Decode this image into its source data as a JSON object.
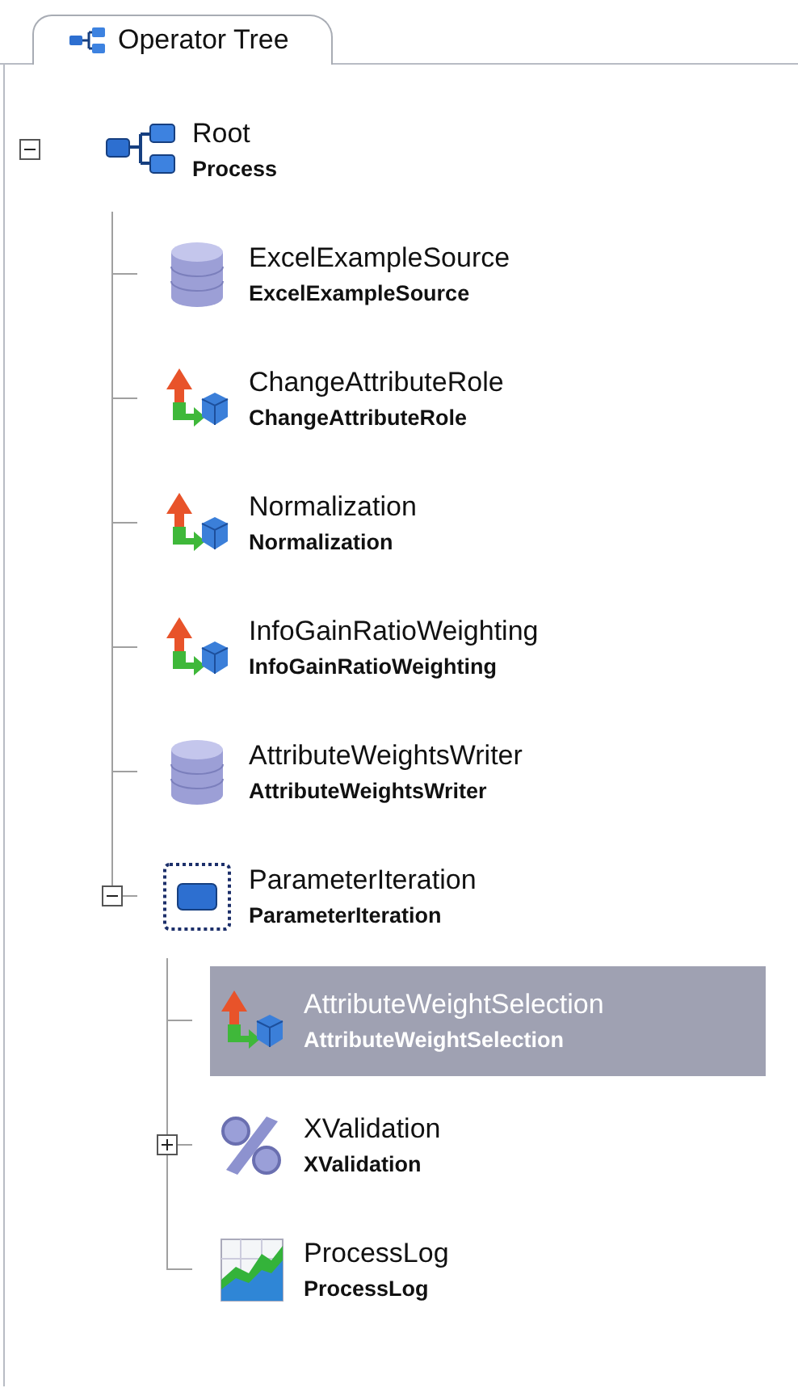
{
  "tab": {
    "label": "Operator Tree",
    "selected": true
  },
  "tree": [
    {
      "name": "Root",
      "type_label": "Process",
      "kind": "process",
      "expanded": true,
      "selected": false,
      "children": [
        {
          "name": "ExcelExampleSource",
          "type_label": "ExcelExampleSource",
          "kind": "source",
          "selected": false
        },
        {
          "name": "ChangeAttributeRole",
          "type_label": "ChangeAttributeRole",
          "kind": "transform",
          "selected": false
        },
        {
          "name": "Normalization",
          "type_label": "Normalization",
          "kind": "transform",
          "selected": false
        },
        {
          "name": "InfoGainRatioWeighting",
          "type_label": "InfoGainRatioWeighting",
          "kind": "transform",
          "selected": false
        },
        {
          "name": "AttributeWeightsWriter",
          "type_label": "AttributeWeightsWriter",
          "kind": "source",
          "selected": false
        },
        {
          "name": "ParameterIteration",
          "type_label": "ParameterIteration",
          "kind": "chain",
          "expanded": true,
          "selected": false,
          "children": [
            {
              "name": "AttributeWeightSelection",
              "type_label": "AttributeWeightSelection",
              "kind": "transform",
              "selected": true
            },
            {
              "name": "XValidation",
              "type_label": "XValidation",
              "kind": "validation",
              "expanded": false,
              "selected": false
            },
            {
              "name": "ProcessLog",
              "type_label": "ProcessLog",
              "kind": "log",
              "selected": false
            }
          ]
        }
      ]
    }
  ]
}
